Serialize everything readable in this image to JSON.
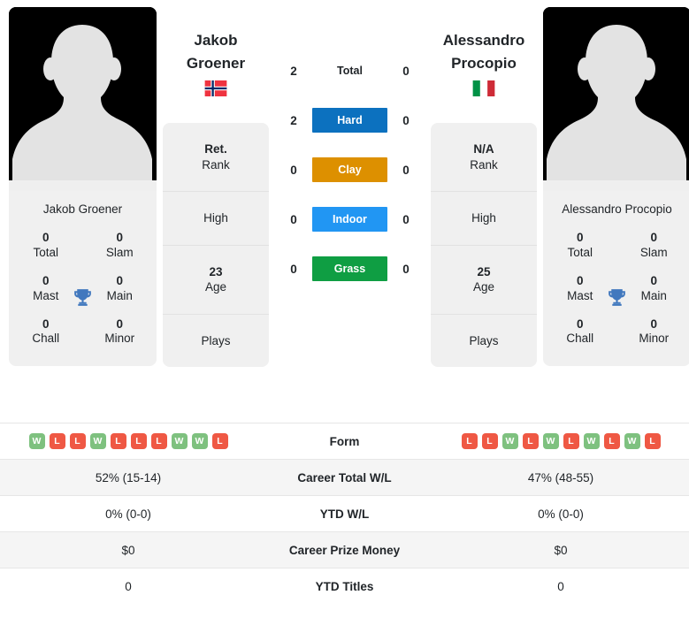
{
  "players": {
    "left": {
      "name": "Jakob Groener",
      "first_line": "Jakob",
      "second_line": "Groener",
      "country": "Norway",
      "flag_icon": "flag-norway-icon",
      "photo_icon": "player-silhouette-icon",
      "rank_value": "Ret.",
      "rank_label": "Rank",
      "high_label": "High",
      "age_value": "23",
      "age_label": "Age",
      "plays_label": "Plays",
      "titles": [
        {
          "value": "0",
          "label": "Total"
        },
        {
          "value": "0",
          "label": "Slam"
        },
        {
          "value": "0",
          "label": "Mast"
        },
        {
          "value": "0",
          "label": "Main"
        },
        {
          "value": "0",
          "label": "Chall"
        },
        {
          "value": "0",
          "label": "Minor"
        }
      ],
      "form": [
        "W",
        "L",
        "L",
        "W",
        "L",
        "L",
        "L",
        "W",
        "W",
        "L"
      ],
      "career_total_wl": "52% (15-14)",
      "ytd_wl": "0% (0-0)",
      "career_prize_money": "$0",
      "ytd_titles": "0"
    },
    "right": {
      "name": "Alessandro Procopio",
      "first_line": "Alessandro",
      "second_line": "Procopio",
      "country": "Italy",
      "flag_icon": "flag-italy-icon",
      "photo_icon": "player-silhouette-icon",
      "rank_value": "N/A",
      "rank_label": "Rank",
      "high_label": "High",
      "age_value": "25",
      "age_label": "Age",
      "plays_label": "Plays",
      "titles": [
        {
          "value": "0",
          "label": "Total"
        },
        {
          "value": "0",
          "label": "Slam"
        },
        {
          "value": "0",
          "label": "Mast"
        },
        {
          "value": "0",
          "label": "Main"
        },
        {
          "value": "0",
          "label": "Chall"
        },
        {
          "value": "0",
          "label": "Minor"
        }
      ],
      "form": [
        "L",
        "L",
        "W",
        "L",
        "W",
        "L",
        "W",
        "L",
        "W",
        "L"
      ],
      "career_total_wl": "47% (48-55)",
      "ytd_wl": "0% (0-0)",
      "career_prize_money": "$0",
      "ytd_titles": "0"
    }
  },
  "head_to_head": {
    "rows": [
      {
        "label": "Total",
        "left": "2",
        "right": "0",
        "color": "none",
        "style": "plain"
      },
      {
        "label": "Hard",
        "left": "2",
        "right": "0",
        "color": "#0c71bf",
        "style": "pill"
      },
      {
        "label": "Clay",
        "left": "0",
        "right": "0",
        "color": "#dd9000",
        "style": "pill"
      },
      {
        "label": "Indoor",
        "left": "0",
        "right": "0",
        "color": "#2196f3",
        "style": "pill"
      },
      {
        "label": "Grass",
        "left": "0",
        "right": "0",
        "color": "#0f9e43",
        "style": "pill"
      }
    ]
  },
  "stats_table": {
    "rows": [
      {
        "label": "Form",
        "type": "form"
      },
      {
        "label": "Career Total W/L",
        "type": "text",
        "key": "career_total_wl"
      },
      {
        "label": "YTD W/L",
        "type": "text",
        "key": "ytd_wl"
      },
      {
        "label": "Career Prize Money",
        "type": "text",
        "key": "career_prize_money"
      },
      {
        "label": "YTD Titles",
        "type": "text",
        "key": "ytd_titles"
      }
    ]
  },
  "colors": {
    "hard": "#0c71bf",
    "clay": "#dd9000",
    "indoor": "#2196f3",
    "grass": "#0f9e43",
    "win": "#7ec17f",
    "loss": "#ef5844",
    "trophy": "#4178be",
    "card_bg": "#f0f0f0",
    "alt_row": "#f5f5f5"
  }
}
